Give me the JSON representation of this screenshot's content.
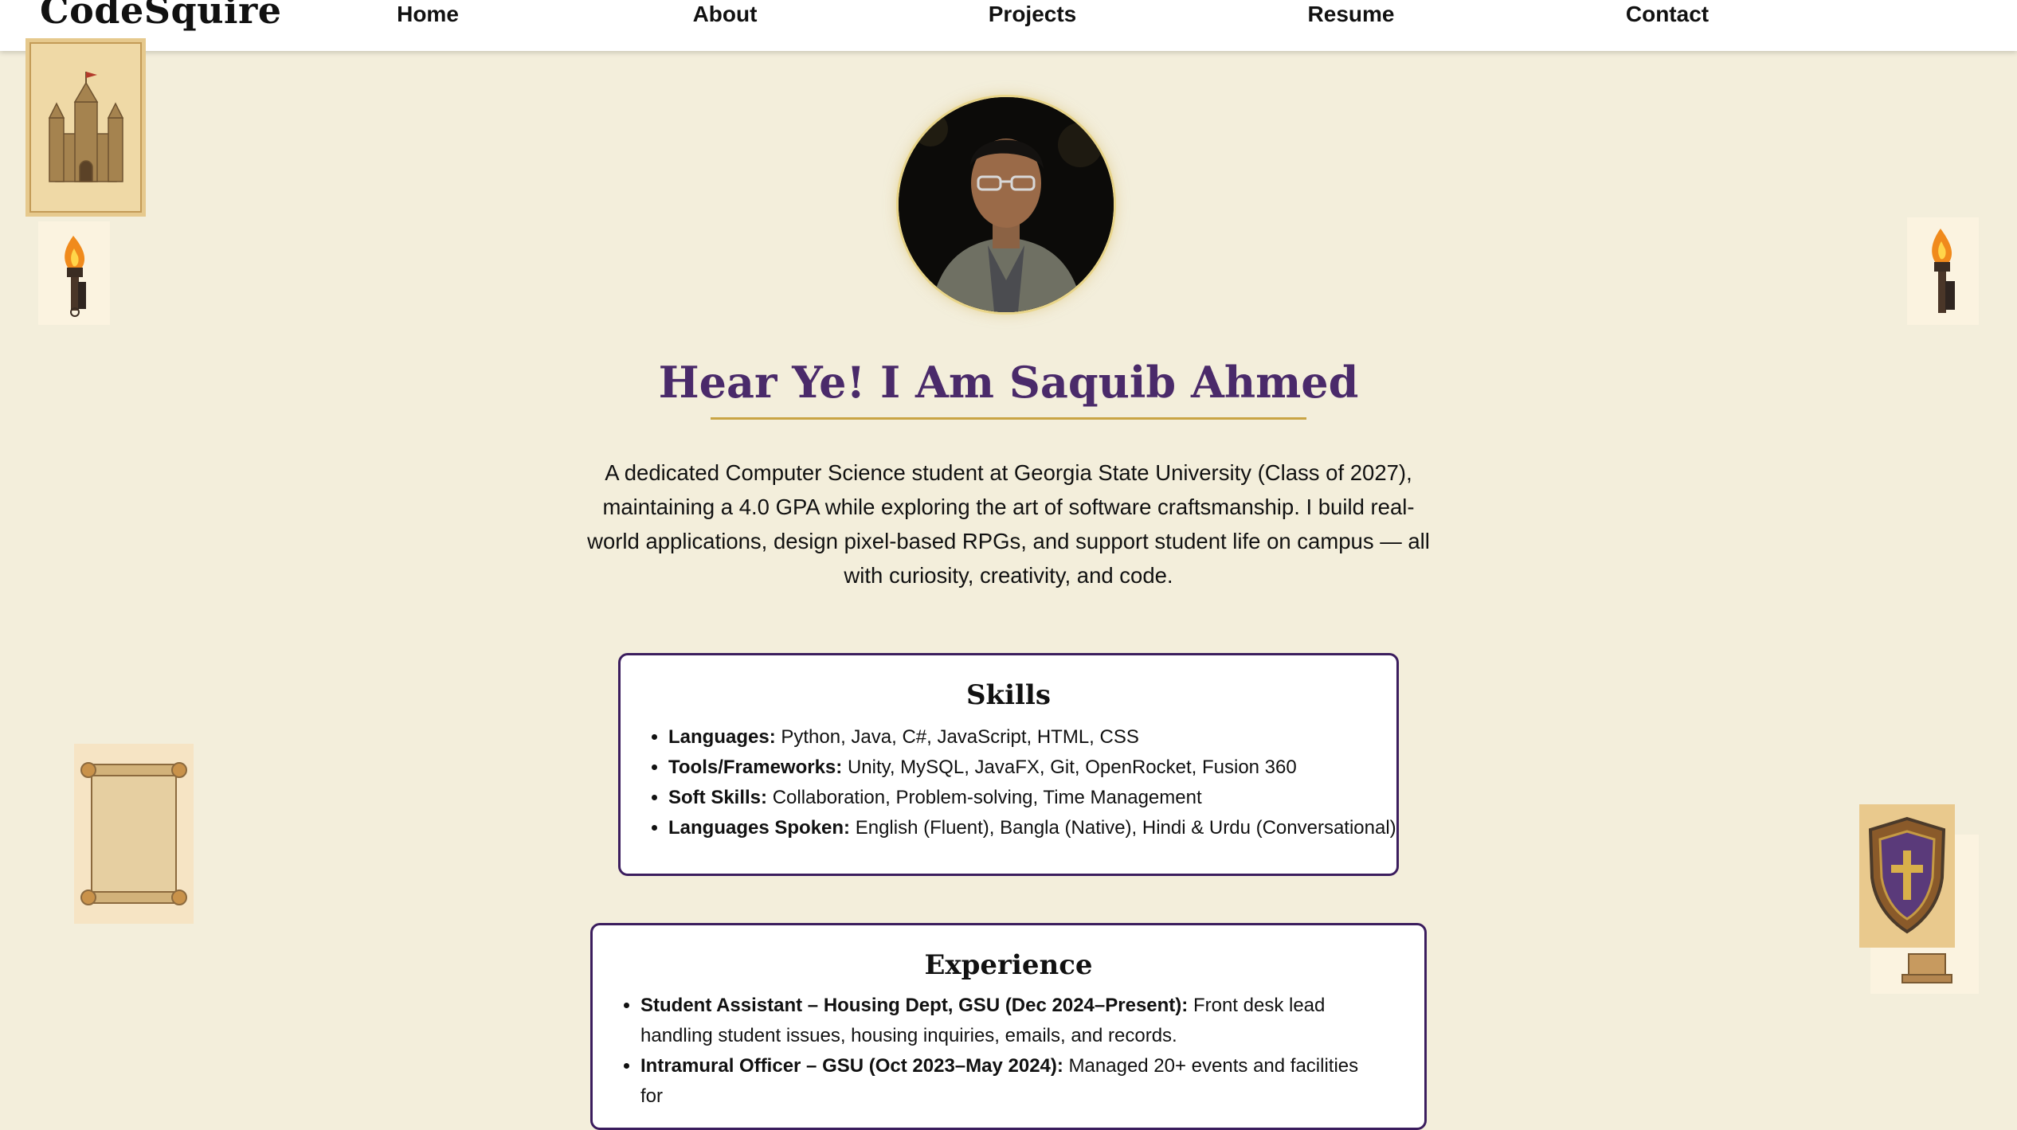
{
  "nav": {
    "brand": "CodeSquire",
    "links": [
      "Home",
      "About",
      "Projects",
      "Resume",
      "Contact"
    ]
  },
  "hero": {
    "title": "Hear Ye! I Am Saquib Ahmed",
    "intro": "A dedicated Computer Science student at Georgia State University (Class of 2027), maintaining a 4.0 GPA while exploring the art of software craftsmanship. I build real-world applications, design pixel-based RPGs, and support student life on campus — all with curiosity, creativity, and code."
  },
  "skills": {
    "title": "Skills",
    "items": [
      {
        "label": "Languages:",
        "text": " Python, Java, C#, JavaScript, HTML, CSS"
      },
      {
        "label": "Tools/Frameworks:",
        "text": " Unity, MySQL, JavaFX, Git, OpenRocket, Fusion 360"
      },
      {
        "label": "Soft Skills:",
        "text": " Collaboration, Problem-solving, Time Management"
      },
      {
        "label": "Languages Spoken:",
        "text": " English (Fluent), Bangla (Native), Hindi & Urdu (Conversational)"
      }
    ]
  },
  "experience": {
    "title": "Experience",
    "items": [
      {
        "label": "Student Assistant – Housing Dept, GSU (Dec 2024–Present):",
        "text": " Front desk lead handling student issues, housing inquiries, emails, and records."
      },
      {
        "label": "Intramural Officer – GSU (Oct 2023–May 2024):",
        "text": " Managed 20+ events and facilities for"
      }
    ]
  },
  "decorations": {
    "icons": [
      "castle-scroll-icon",
      "torch-icon",
      "torch-icon",
      "parchment-scroll-icon",
      "shield-icon",
      "pedestal-icon"
    ]
  },
  "colors": {
    "background": "#f3eedb",
    "accent_purple": "#4a2a6a",
    "card_border": "#3b1d5e",
    "gold": "#c9a444"
  }
}
